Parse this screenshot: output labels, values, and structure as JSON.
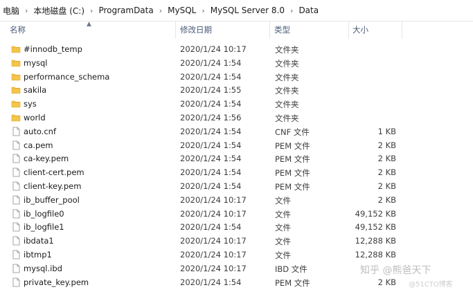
{
  "breadcrumb": [
    "电脑",
    "本地磁盘 (C:)",
    "ProgramData",
    "MySQL",
    "MySQL Server 8.0",
    "Data"
  ],
  "columns": {
    "name": "名称",
    "date": "修改日期",
    "type": "类型",
    "size": "大小"
  },
  "files": [
    {
      "name": "#innodb_temp",
      "date": "2020/1/24 10:17",
      "type": "文件夹",
      "size": "",
      "kind": "folder"
    },
    {
      "name": "mysql",
      "date": "2020/1/24 1:54",
      "type": "文件夹",
      "size": "",
      "kind": "folder"
    },
    {
      "name": "performance_schema",
      "date": "2020/1/24 1:54",
      "type": "文件夹",
      "size": "",
      "kind": "folder"
    },
    {
      "name": "sakila",
      "date": "2020/1/24 1:55",
      "type": "文件夹",
      "size": "",
      "kind": "folder"
    },
    {
      "name": "sys",
      "date": "2020/1/24 1:54",
      "type": "文件夹",
      "size": "",
      "kind": "folder"
    },
    {
      "name": "world",
      "date": "2020/1/24 1:56",
      "type": "文件夹",
      "size": "",
      "kind": "folder"
    },
    {
      "name": "auto.cnf",
      "date": "2020/1/24 1:54",
      "type": "CNF 文件",
      "size": "1 KB",
      "kind": "file"
    },
    {
      "name": "ca.pem",
      "date": "2020/1/24 1:54",
      "type": "PEM 文件",
      "size": "2 KB",
      "kind": "file"
    },
    {
      "name": "ca-key.pem",
      "date": "2020/1/24 1:54",
      "type": "PEM 文件",
      "size": "2 KB",
      "kind": "file"
    },
    {
      "name": "client-cert.pem",
      "date": "2020/1/24 1:54",
      "type": "PEM 文件",
      "size": "2 KB",
      "kind": "file"
    },
    {
      "name": "client-key.pem",
      "date": "2020/1/24 1:54",
      "type": "PEM 文件",
      "size": "2 KB",
      "kind": "file"
    },
    {
      "name": "ib_buffer_pool",
      "date": "2020/1/24 10:17",
      "type": "文件",
      "size": "2 KB",
      "kind": "file"
    },
    {
      "name": "ib_logfile0",
      "date": "2020/1/24 10:17",
      "type": "文件",
      "size": "49,152 KB",
      "kind": "file"
    },
    {
      "name": "ib_logfile1",
      "date": "2020/1/24 1:54",
      "type": "文件",
      "size": "49,152 KB",
      "kind": "file"
    },
    {
      "name": "ibdata1",
      "date": "2020/1/24 10:17",
      "type": "文件",
      "size": "12,288 KB",
      "kind": "file"
    },
    {
      "name": "ibtmp1",
      "date": "2020/1/24 10:17",
      "type": "文件",
      "size": "12,288 KB",
      "kind": "file"
    },
    {
      "name": "mysql.ibd",
      "date": "2020/1/24 10:17",
      "type": "IBD 文件",
      "size": "",
      "kind": "file"
    },
    {
      "name": "private_key.pem",
      "date": "2020/1/24 1:54",
      "type": "PEM 文件",
      "size": "2 KB",
      "kind": "file"
    }
  ],
  "watermark": "知乎 @熊爸天下",
  "watermark_small": "@51CTO博客",
  "colors": {
    "folder": "#f3c54b",
    "folder_dark": "#e2a92a",
    "header_text": "#4a5b78"
  },
  "icons": {
    "folder": "folder-icon",
    "file": "file-icon"
  }
}
